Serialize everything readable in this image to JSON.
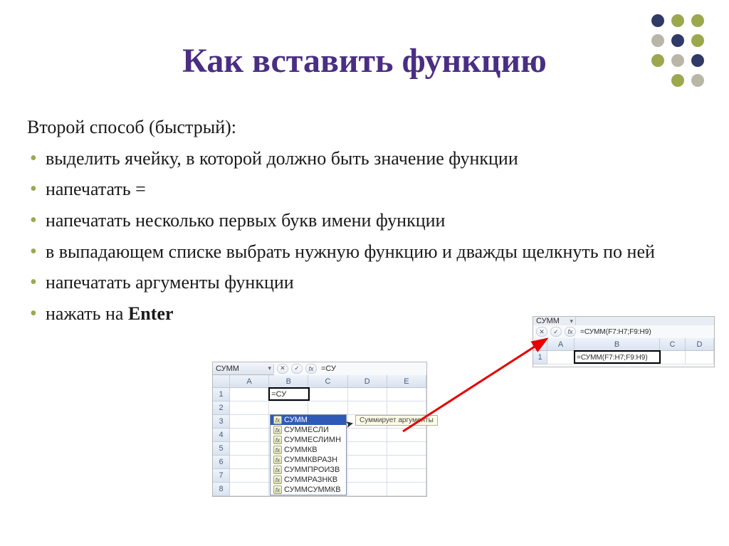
{
  "title": "Как вставить функцию",
  "subtitle": "Второй способ (быстрый):",
  "bullets": [
    "выделить ячейку, в которой должно быть значение функции",
    "напечатать =",
    "напечатать несколько первых букв имени функции",
    "в выпадающем списке выбрать нужную функцию и дважды щелкнуть по ней",
    "напечатать аргументы функции",
    "нажать на "
  ],
  "enter_label": "Enter",
  "excel": {
    "namebox": "СУММ",
    "fx_symbol": "fx",
    "columns": [
      "A",
      "B",
      "C",
      "D",
      "E"
    ],
    "rows": [
      "1",
      "2",
      "3",
      "4",
      "5",
      "6",
      "7",
      "8"
    ],
    "cell_b1": "=СУ",
    "formula_bar_1": "=СУ",
    "dropdown_items": [
      "СУММ",
      "СУММЕСЛИ",
      "СУММЕСЛИМН",
      "СУММКВ",
      "СУММКВРАЗН",
      "СУММПРОИЗВ",
      "СУММРАЗНКВ",
      "СУММСУММКВ"
    ],
    "tooltip": "Суммирует аргументы",
    "formula_full": "=СУММ(F7:H7;F9:H9)",
    "cell_b1_2": "=СУММ(F7:H7;F9:H9)",
    "columns2": [
      "A",
      "B",
      "C",
      "D"
    ]
  }
}
